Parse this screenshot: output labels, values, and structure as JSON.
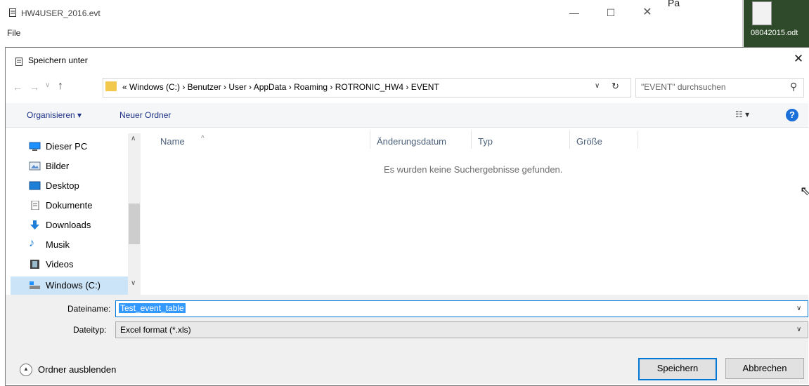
{
  "background_window": {
    "title": "HW4USER_2016.evt",
    "menu": "File",
    "controls": {
      "minimize": "—",
      "maximize": "☐",
      "close": "✕"
    },
    "cell_text": "Pa"
  },
  "desktop": {
    "icon_label": "08042015.odt"
  },
  "dialog": {
    "title": "Speichern unter",
    "close": "✕",
    "address": {
      "path": "« Windows (C:)  ›  Benutzer  ›  User  ›  AppData  ›  Roaming  ›  ROTRONIC_HW4  ›  EVENT"
    },
    "search": {
      "placeholder": "\"EVENT\" durchsuchen"
    },
    "toolbar": {
      "organize": "Organisieren ▾",
      "new_folder": "Neuer Ordner"
    },
    "nav": {
      "items": [
        {
          "label": "Dieser PC",
          "icon": "pc-icon"
        },
        {
          "label": "Bilder",
          "icon": "pictures-icon"
        },
        {
          "label": "Desktop",
          "icon": "desktop-icon"
        },
        {
          "label": "Dokumente",
          "icon": "documents-icon"
        },
        {
          "label": "Downloads",
          "icon": "downloads-icon"
        },
        {
          "label": "Musik",
          "icon": "music-icon"
        },
        {
          "label": "Videos",
          "icon": "videos-icon"
        },
        {
          "label": "Windows (C:)",
          "icon": "drive-icon"
        }
      ]
    },
    "columns": {
      "name": "Name",
      "date": "Änderungsdatum",
      "type": "Typ",
      "size": "Größe"
    },
    "empty_message": "Es wurden keine Suchergebnisse gefunden.",
    "filename": {
      "label": "Dateiname:",
      "value": "Test_event_table"
    },
    "filetype": {
      "label": "Dateityp:",
      "value": "Excel format (*.xls)"
    },
    "hide_folders": "Ordner ausblenden",
    "buttons": {
      "save": "Speichern",
      "cancel": "Abbrechen"
    }
  }
}
